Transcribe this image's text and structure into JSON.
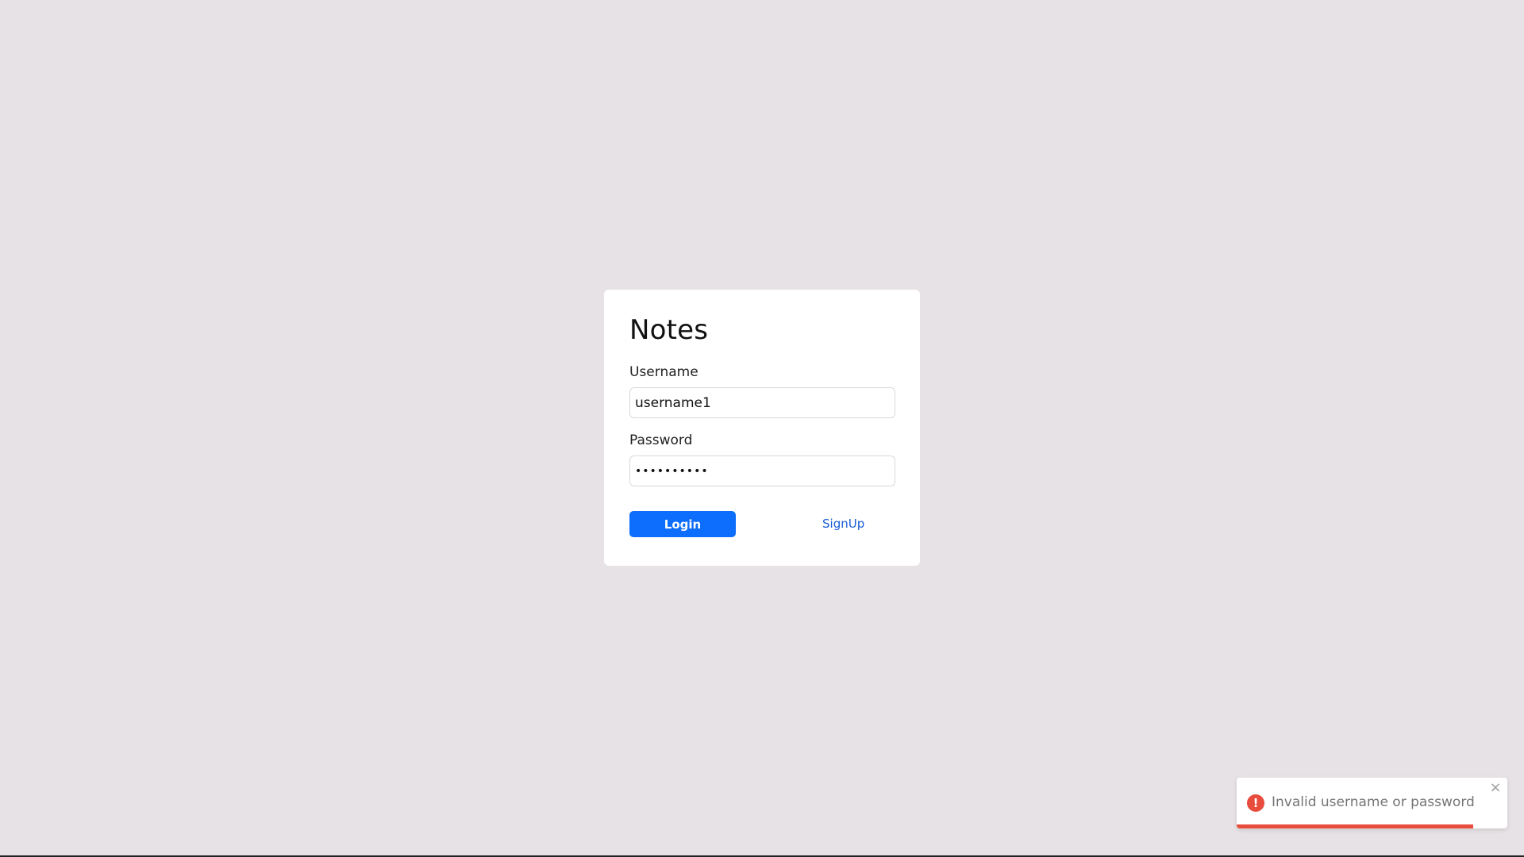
{
  "app": {
    "title": "Notes"
  },
  "login_form": {
    "username_label": "Username",
    "username_value": "username1",
    "password_label": "Password",
    "password_value": "••••••••••",
    "login_label": "Login",
    "signup_label": "SignUp"
  },
  "toast": {
    "message": "Invalid username or password",
    "close_icon": "close-icon",
    "status_icon": "error-icon",
    "status_glyph": "!",
    "progress_fraction": 0.875
  },
  "colors": {
    "background": "#e7e2e6",
    "card": "#ffffff",
    "primary_button": "#0d6efd",
    "link": "#1a5fd6",
    "error": "#e74c3c"
  }
}
